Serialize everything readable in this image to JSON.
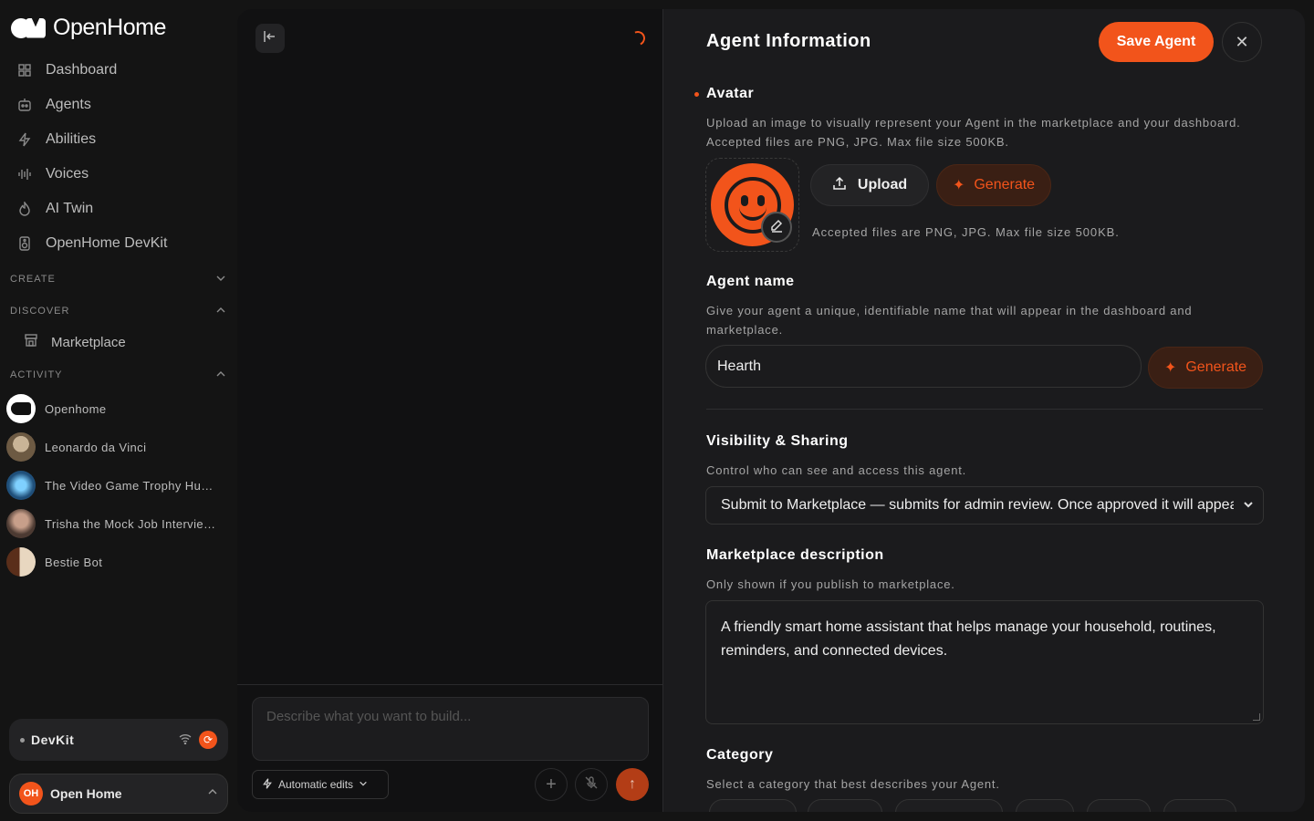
{
  "app": {
    "name": "OpenHome"
  },
  "sidebar": {
    "nav": [
      {
        "label": "Dashboard",
        "icon": "grid-icon"
      },
      {
        "label": "Agents",
        "icon": "robot-icon"
      },
      {
        "label": "Abilities",
        "icon": "bolt-icon"
      },
      {
        "label": "Voices",
        "icon": "waveform-icon"
      },
      {
        "label": "AI Twin",
        "icon": "flame-icon"
      },
      {
        "label": "OpenHome DevKit",
        "icon": "speaker-icon"
      }
    ],
    "sections": {
      "create": "CREATE",
      "discover": "DISCOVER",
      "activity": "ACTIVITY"
    },
    "discover_items": [
      {
        "label": "Marketplace",
        "icon": "store-icon"
      }
    ],
    "activity": [
      {
        "label": "Openhome",
        "color": "#ffffff"
      },
      {
        "label": "Leonardo da Vinci",
        "color": "#8a7358"
      },
      {
        "label": "The Video Game Trophy Hunter",
        "color": "#2d6f9c"
      },
      {
        "label": "Trisha the Mock Job Interviewer",
        "color": "#9b7a6a"
      },
      {
        "label": "Bestie Bot",
        "color": "#a86a3d"
      }
    ],
    "devkit": {
      "label": "DevKit"
    },
    "account": {
      "initials": "OH",
      "name": "Open Home"
    }
  },
  "composer": {
    "placeholder": "Describe what you want to build...",
    "auto_edits": "Automatic edits"
  },
  "form": {
    "title": "Agent Information",
    "save": "Save Agent",
    "avatar": {
      "label": "Avatar",
      "help": "Upload an image to visually represent your Agent in the marketplace and your dashboard. Accepted files are PNG, JPG. Max file size 500KB.",
      "upload": "Upload",
      "generate": "Generate",
      "small_help": "Accepted files are PNG, JPG. Max file size 500KB."
    },
    "name": {
      "label": "Agent name",
      "help": "Give your agent a unique, identifiable name that will appear in the dashboard and marketplace.",
      "value": "Hearth",
      "generate": "Generate"
    },
    "visibility": {
      "label": "Visibility & Sharing",
      "help": "Control who can see and access this agent.",
      "selected": "Submit to Marketplace — submits for admin review. Once approved it will appear in the marketplace"
    },
    "description": {
      "label": "Marketplace description",
      "help": "Only shown if you publish to marketplace.",
      "value": "A friendly smart home assistant that helps manage your household, routines, reminders, and connected devices."
    },
    "category": {
      "label": "Category",
      "help": "Select a category that best describes your Agent."
    }
  },
  "colors": {
    "accent": "#f2541b",
    "background": "#141414",
    "panel": "#1b1b1d"
  }
}
